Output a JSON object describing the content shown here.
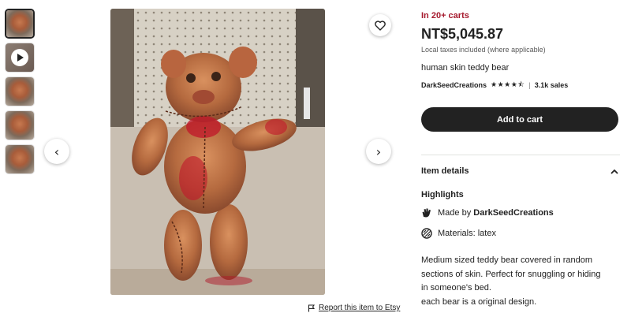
{
  "thumbnails": [
    {
      "kind": "image",
      "active": true
    },
    {
      "kind": "video",
      "active": false
    },
    {
      "kind": "image",
      "active": false
    },
    {
      "kind": "image",
      "active": false
    },
    {
      "kind": "image",
      "active": false
    }
  ],
  "gallery": {
    "prev_icon": "chevron-left-icon",
    "next_icon": "chevron-right-icon",
    "favorite_icon": "heart-icon"
  },
  "report": {
    "icon": "flag-icon",
    "label": "Report this item to Etsy"
  },
  "listing": {
    "cart_count_text": "In 20+ carts",
    "price": "NT$5,045.87",
    "tax_note": "Local taxes included (where applicable)",
    "title": "human skin teddy bear",
    "seller": "DarkSeedCreations",
    "rating_stars": 4.5,
    "sales": "3.1k sales",
    "add_to_cart": "Add to cart"
  },
  "details": {
    "heading": "Item details",
    "highlights_heading": "Highlights",
    "made_by_prefix": "Made by",
    "made_by_shop": "DarkSeedCreations",
    "materials": "Materials: latex",
    "description": [
      "Medium sized teddy bear covered in random",
      "sections of skin. Perfect for snuggling or hiding",
      "in someone's bed.",
      "each bear is a original design."
    ]
  },
  "colors": {
    "accent_red": "#a61a2e",
    "button_dark": "#222222"
  }
}
